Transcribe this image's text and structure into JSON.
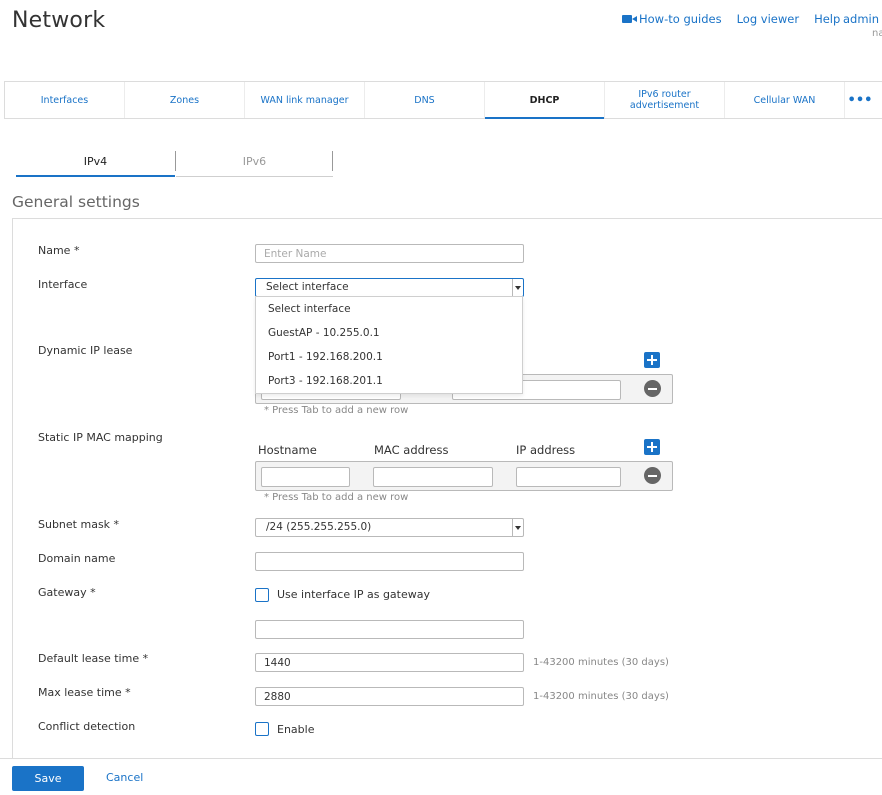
{
  "page": {
    "title": "Network"
  },
  "header": {
    "links": {
      "howto": "How-to guides",
      "logviewer": "Log viewer",
      "help": "Help"
    },
    "user": "admin",
    "user_sub": "na"
  },
  "tabs": {
    "interfaces": "Interfaces",
    "zones": "Zones",
    "wan": "WAN link manager",
    "dns": "DNS",
    "dhcp": "DHCP",
    "ipv6_line1": "IPv6 router",
    "ipv6_line2": "advertisement",
    "cellular": "Cellular WAN",
    "more": "•••"
  },
  "subtabs": {
    "ipv4": "IPv4",
    "ipv6": "IPv6"
  },
  "section": {
    "title": "General settings"
  },
  "form": {
    "name": {
      "label": "Name *",
      "placeholder": "Enter Name",
      "value": ""
    },
    "interface": {
      "label": "Interface",
      "selected": "Select interface",
      "options": [
        "Select interface",
        "GuestAP - 10.255.0.1",
        "Port1 - 192.168.200.1",
        "Port3 - 192.168.201.1"
      ]
    },
    "dynamic_ip": {
      "label": "Dynamic IP lease",
      "hint": "* Press Tab to add a new row"
    },
    "static_mapping": {
      "label": "Static IP MAC mapping",
      "columns": [
        "Hostname",
        "MAC address",
        "IP address"
      ],
      "hint": "* Press Tab to add a new row"
    },
    "subnet": {
      "label": "Subnet mask *",
      "value": "/24 (255.255.255.0)"
    },
    "domain": {
      "label": "Domain name",
      "value": ""
    },
    "gateway": {
      "label": "Gateway *",
      "checkbox_label": "Use interface IP as gateway",
      "value": ""
    },
    "default_lease": {
      "label": "Default lease time *",
      "value": "1440",
      "hint": "1-43200 minutes (30 days)"
    },
    "max_lease": {
      "label": "Max lease time *",
      "value": "2880",
      "hint": "1-43200 minutes (30 days)"
    },
    "conflict": {
      "label": "Conflict detection",
      "checkbox_label": "Enable"
    }
  },
  "footer": {
    "save": "Save",
    "cancel": "Cancel"
  },
  "colors": {
    "accent": "#1a73c7",
    "border": "#dcdcdc",
    "icon_gray": "#666666"
  }
}
